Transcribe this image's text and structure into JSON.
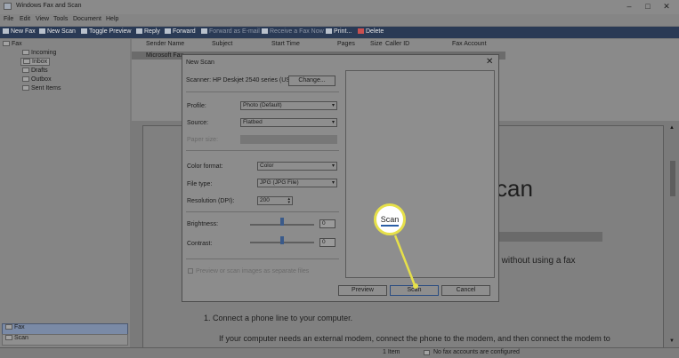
{
  "app": {
    "title": "Windows Fax and Scan"
  },
  "menu": [
    "File",
    "Edit",
    "View",
    "Tools",
    "Document",
    "Help"
  ],
  "toolbar": {
    "new_fax": "New Fax",
    "new_scan": "New Scan",
    "toggle_preview": "Toggle Preview",
    "reply": "Reply",
    "forward": "Forward",
    "forward_email": "Forward as E-mail",
    "receive_fax": "Receive a Fax Now",
    "print": "Print...",
    "delete": "Delete"
  },
  "sidebar": {
    "root": "Fax",
    "items": [
      "Incoming",
      "Inbox",
      "Drafts",
      "Outbox",
      "Sent Items"
    ],
    "selected": "Inbox",
    "nav": [
      "Fax",
      "Scan"
    ]
  },
  "list": {
    "columns": [
      "Sender Name",
      "Subject",
      "Start Time",
      "Pages",
      "Size",
      "Caller ID",
      "Fax Account"
    ],
    "rows": [
      {
        "sender": "Microsoft Fax"
      }
    ]
  },
  "preview": {
    "heading_fragment": "can",
    "line_fragment": "er without using a fax",
    "step1": "1.     Connect a phone line to your computer.",
    "step1_detail": "If your computer needs an external modem, connect the phone to the modem, and then connect the modem to"
  },
  "status": {
    "count": "1 Item",
    "accounts": "No fax accounts are configured"
  },
  "dialog": {
    "title": "New Scan",
    "scanner_label": "Scanner: HP Deskjet 2540 series (USB)",
    "change_button": "Change...",
    "profile_label": "Profile:",
    "profile_value": "Photo (Default)",
    "source_label": "Source:",
    "source_value": "Flatbed",
    "paper_size_label": "Paper size:",
    "color_format_label": "Color format:",
    "color_format_value": "Color",
    "file_type_label": "File type:",
    "file_type_value": "JPG (JPG File)",
    "resolution_label": "Resolution (DPI):",
    "resolution_value": "200",
    "brightness_label": "Brightness:",
    "brightness_value": "0",
    "contrast_label": "Contrast:",
    "contrast_value": "0",
    "separate_files_label": "Preview or scan images as separate files",
    "preview_button": "Preview",
    "scan_button": "Scan",
    "cancel_button": "Cancel"
  },
  "callout": {
    "label": "Scan",
    "color": "#e6e04a"
  }
}
